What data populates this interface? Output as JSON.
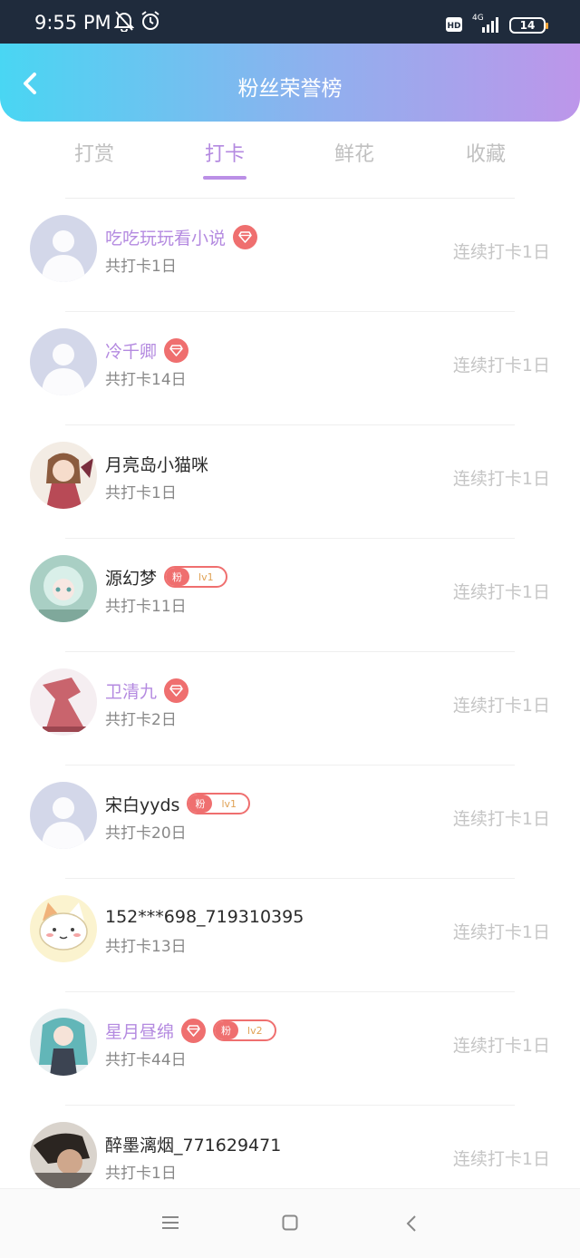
{
  "status_bar": {
    "time": "9:55 PM",
    "network": "4G",
    "battery": "14"
  },
  "header": {
    "title": "粉丝荣誉榜"
  },
  "tabs": [
    {
      "label": "打赏",
      "active": false
    },
    {
      "label": "打卡",
      "active": true
    },
    {
      "label": "鲜花",
      "active": false
    },
    {
      "label": "收藏",
      "active": false
    }
  ],
  "fans": [
    {
      "name": "吃吃玩玩看小说",
      "vip": true,
      "gem": true,
      "badge": null,
      "total": "共打卡1日",
      "streak": "连续打卡1日",
      "avatar": "default"
    },
    {
      "name": "冷千卿",
      "vip": true,
      "gem": true,
      "badge": null,
      "total": "共打卡14日",
      "streak": "连续打卡1日",
      "avatar": "default"
    },
    {
      "name": "月亮岛小猫咪",
      "vip": false,
      "gem": false,
      "badge": null,
      "total": "共打卡1日",
      "streak": "连续打卡1日",
      "avatar": "anime-girl-red"
    },
    {
      "name": "源幻梦",
      "vip": false,
      "gem": false,
      "badge": {
        "label": "粉",
        "level": "lv1"
      },
      "total": "共打卡11日",
      "streak": "连续打卡1日",
      "avatar": "anime-girl-mint"
    },
    {
      "name": "卫清九",
      "vip": true,
      "gem": true,
      "badge": null,
      "total": "共打卡2日",
      "streak": "连续打卡1日",
      "avatar": "pink-dress"
    },
    {
      "name": "宋白yyds",
      "vip": false,
      "gem": false,
      "badge": {
        "label": "粉",
        "level": "lv1"
      },
      "total": "共打卡20日",
      "streak": "连续打卡1日",
      "avatar": "default"
    },
    {
      "name": "152***698_719310395",
      "vip": false,
      "gem": false,
      "badge": null,
      "total": "共打卡13日",
      "streak": "连续打卡1日",
      "avatar": "cat"
    },
    {
      "name": "星月昼绵",
      "vip": true,
      "gem": true,
      "badge": {
        "label": "粉",
        "level": "lv2"
      },
      "total": "共打卡44日",
      "streak": "连续打卡1日",
      "avatar": "anime-girl-teal"
    },
    {
      "name": "醉墨漓烟_771629471",
      "vip": false,
      "gem": false,
      "badge": null,
      "total": "共打卡1日",
      "streak": "连续打卡1日",
      "avatar": "dark-photo"
    }
  ],
  "colors": {
    "accent": "#b48ae0",
    "badge": "#ef6f6f",
    "gradient_start": "#49d6f3",
    "gradient_end": "#bd96ea"
  },
  "icons": {
    "back": "chevron-left-icon",
    "gem": "diamond-icon",
    "nav_menu": "menu-icon",
    "nav_home": "square-home-icon",
    "nav_back": "triangle-back-icon"
  }
}
